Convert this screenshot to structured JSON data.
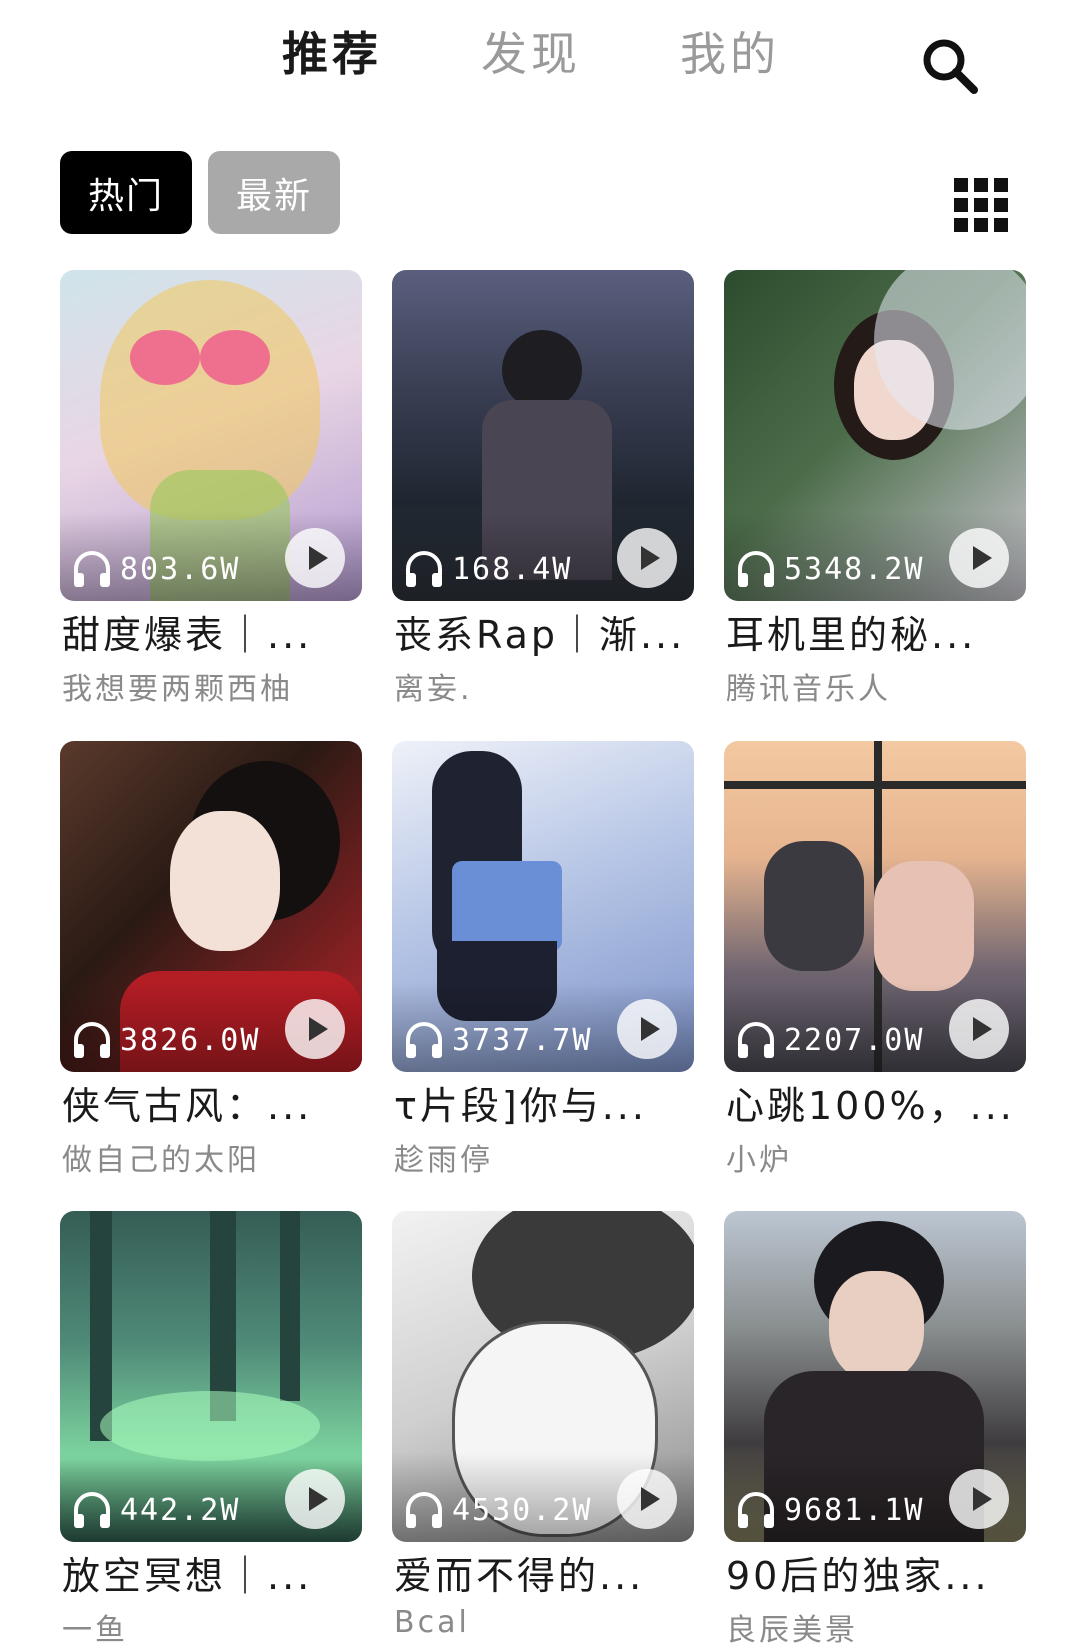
{
  "nav": {
    "tabs": [
      {
        "label": "推荐",
        "active": true
      },
      {
        "label": "发现",
        "active": false
      },
      {
        "label": "我的",
        "active": false
      }
    ],
    "search_icon": "search-icon"
  },
  "filters": {
    "chips": [
      {
        "label": "热门",
        "selected": true
      },
      {
        "label": "最新",
        "selected": false
      }
    ],
    "grid_icon": "grid-view-icon"
  },
  "playlists": [
    {
      "plays": "803.6W",
      "title": "甜度爆表｜...",
      "author": "我想要两颗西柚"
    },
    {
      "plays": "168.4W",
      "title": "丧系Rap｜渐...",
      "author": "离妄."
    },
    {
      "plays": "5348.2W",
      "title": "耳机里的秘...",
      "author": "腾讯音乐人"
    },
    {
      "plays": "3826.0W",
      "title": "侠气古风：...",
      "author": "做自己的太阳"
    },
    {
      "plays": "3737.7W",
      "title": "τ片段]你与...",
      "author": "趁雨停"
    },
    {
      "plays": "2207.0W",
      "title": "心跳100%，...",
      "author": "小炉"
    },
    {
      "plays": "442.2W",
      "title": "放空冥想｜...",
      "author": "一鱼"
    },
    {
      "plays": "4530.2W",
      "title": "爱而不得的...",
      "author": "Bcal"
    },
    {
      "plays": "9681.1W",
      "title": "90后的独家...",
      "author": "良辰美景"
    }
  ],
  "colors": {
    "active_chip": "#000000",
    "inactive_chip": "#a9a9a9",
    "inactive_tab": "#9a9a9a",
    "author_text": "#8a8a8a"
  }
}
